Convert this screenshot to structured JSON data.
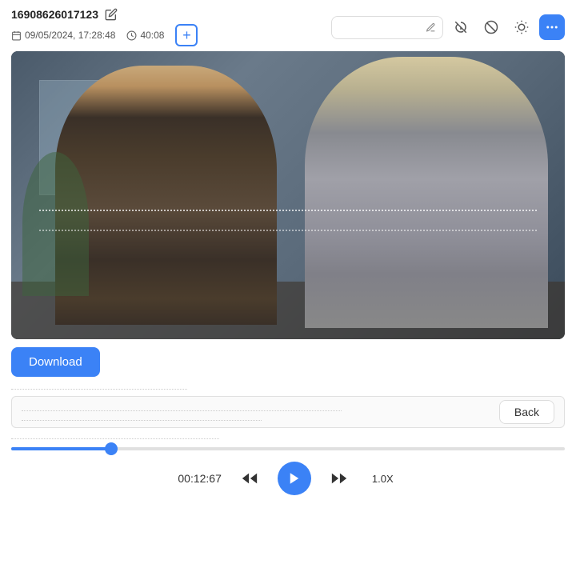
{
  "header": {
    "id": "16908626017123",
    "date": "09/05/2024, 17:28:48",
    "duration": "40:08",
    "search_placeholder": ""
  },
  "toolbar": {
    "edit_icon": "pencil",
    "add_label": "+",
    "filter1_icon": "hearing-off",
    "filter2_icon": "no-entry",
    "brightness_icon": "brightness",
    "more_icon": "ellipsis"
  },
  "video": {
    "overlay_lines": true
  },
  "download": {
    "label": "Download"
  },
  "text_area": {
    "line1": ".................................................",
    "line2": ".................................................",
    "back_label": "Back",
    "bottom_line": "................................................."
  },
  "playback": {
    "time": "00:12:67",
    "speed": "1.0X",
    "progress_percent": 18
  }
}
